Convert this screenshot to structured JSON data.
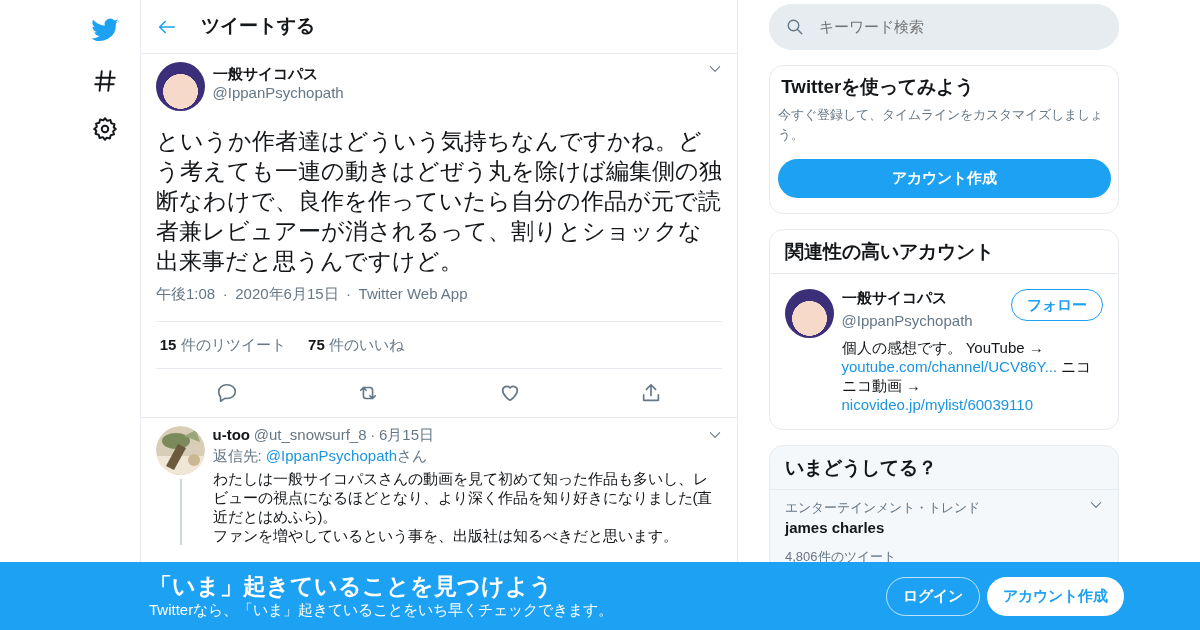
{
  "header": {
    "title": "ツイートする"
  },
  "tweet": {
    "name": "一般サイコパス",
    "handle": "@IppanPsychopath",
    "text": "というか作者達はどういう気持ちなんですかね。どう考えても一連の動きはどぜう丸を除けば編集側の独断なわけで、良作を作っていたら自分の作品が元で読者兼レビュアーが消されるって、割りとショックな出来事だと思うんですけど。",
    "meta": [
      "午後1:08",
      "2020年6月15日",
      "Twitter Web App"
    ],
    "separator": "·",
    "stats": [
      "**15** 件のリツイート",
      "**75** 件のいいね"
    ]
  },
  "reply": {
    "name": "u-too",
    "handle": "@ut_snowsurf_8",
    "separator": "·",
    "date": "6月15日",
    "reply_to": [
      {
        "text": "返信先: ",
        "kind": "text"
      },
      {
        "text": "@IppanPsychopath",
        "kind": "link"
      },
      {
        "text": "さん",
        "kind": "text"
      }
    ],
    "lines": [
      "わたしは一般サイコパスさんの動画を見て初めて知った作品も多いし、レビューの視点になるほどとなり、より深く作品を知り好きになりました(直近だとはめふら)。",
      "ファンを増やしているという事を、出版社は知るべきだと思います。"
    ]
  },
  "search": {
    "placeholder": "キーワード検索"
  },
  "signup_card": {
    "title": "Twitterを使ってみよう",
    "text": "今すぐ登録して、タイムラインをカスタマイズしましょう。",
    "button": "アカウント作成"
  },
  "related": {
    "title": "関連性の高いアカウント",
    "name": "一般サイコパス",
    "handle": "@IppanPsychopath",
    "follow": "フォロー",
    "bio": [
      {
        "text": "個人の感想です。 YouTube → ",
        "kind": "text"
      },
      {
        "text": "youtube.com/channel/UCV86Y...",
        "kind": "link"
      },
      {
        "text": " ニコニコ動画 → ",
        "kind": "text"
      },
      {
        "text": "nicovideo.jp/mylist/60039110",
        "kind": "link"
      }
    ]
  },
  "trends": {
    "title": "いまどうしてる？",
    "items": [
      {
        "category": "エンターテインメント・トレンド",
        "name": "james charles",
        "count": "4,806件のツイート"
      }
    ]
  },
  "banner": {
    "title": "「いま」起きていることを見つけよう",
    "text": "Twitterなら、「いま」起きていることをいち早くチェックできます。",
    "login": "ログイン",
    "signup": "アカウント作成"
  }
}
